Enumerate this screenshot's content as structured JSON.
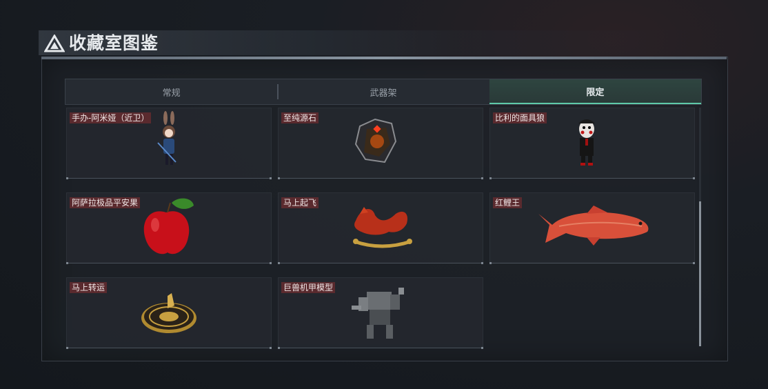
{
  "header": {
    "title": "收藏室图鉴",
    "logo_icon": "triangle-logo-icon"
  },
  "tabs": [
    {
      "label": "常规",
      "active": false
    },
    {
      "label": "武器架",
      "active": false
    },
    {
      "label": "限定",
      "active": true
    }
  ],
  "items": [
    {
      "label": "手办-阿米娅（近卫）",
      "icon": "figure-amiya-icon"
    },
    {
      "label": "至纯源石",
      "icon": "crystal-icon"
    },
    {
      "label": "比利的面具狼",
      "icon": "puppet-icon"
    },
    {
      "label": "阿萨拉极品平安果",
      "icon": "apple-icon"
    },
    {
      "label": "马上起飞",
      "icon": "horse-sculpture-icon"
    },
    {
      "label": "红鲤王",
      "icon": "carp-icon"
    },
    {
      "label": "马上转运",
      "icon": "compass-disc-icon"
    },
    {
      "label": "巨兽机甲模型",
      "icon": "mecha-model-icon"
    }
  ],
  "colors": {
    "accent": "#5fc9a8",
    "label_bg": "#5a2a2e"
  }
}
